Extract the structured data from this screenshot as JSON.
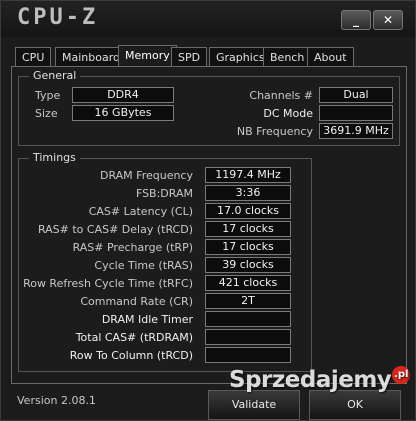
{
  "app": {
    "title": "CPU-Z",
    "minimize": "_",
    "close": "✕"
  },
  "tabs": [
    "CPU",
    "Mainboard",
    "Memory",
    "SPD",
    "Graphics",
    "Bench",
    "About"
  ],
  "active_tab": "Memory",
  "general": {
    "title": "General",
    "type_label": "Type",
    "type_value": "DDR4",
    "size_label": "Size",
    "size_value": "16 GBytes",
    "channels_label": "Channels #",
    "channels_value": "Dual",
    "dcmode_label": "DC Mode",
    "dcmode_value": "",
    "nbfreq_label": "NB Frequency",
    "nbfreq_value": "3691.9 MHz"
  },
  "timings": {
    "title": "Timings",
    "rows": [
      {
        "label": "DRAM Frequency",
        "value": "1197.4 MHz",
        "bright": false
      },
      {
        "label": "FSB:DRAM",
        "value": "3:36",
        "bright": false
      },
      {
        "label": "CAS# Latency (CL)",
        "value": "17.0 clocks",
        "bright": false
      },
      {
        "label": "RAS# to CAS# Delay (tRCD)",
        "value": "17 clocks",
        "bright": false
      },
      {
        "label": "RAS# Precharge (tRP)",
        "value": "17 clocks",
        "bright": false
      },
      {
        "label": "Cycle Time (tRAS)",
        "value": "39 clocks",
        "bright": false
      },
      {
        "label": "Row Refresh Cycle Time (tRFC)",
        "value": "421 clocks",
        "bright": false
      },
      {
        "label": "Command Rate (CR)",
        "value": "2T",
        "bright": false
      },
      {
        "label": "DRAM Idle Timer",
        "value": "",
        "bright": true
      },
      {
        "label": "Total CAS# (tRDRAM)",
        "value": "",
        "bright": true
      },
      {
        "label": "Row To Column (tRCD)",
        "value": "",
        "bright": true
      }
    ]
  },
  "footer": {
    "version": "Version 2.08.1",
    "validate_label": "Validate",
    "ok_label": "OK"
  },
  "watermark": {
    "text": "Sprzedajemy",
    "badge": ".pl"
  }
}
